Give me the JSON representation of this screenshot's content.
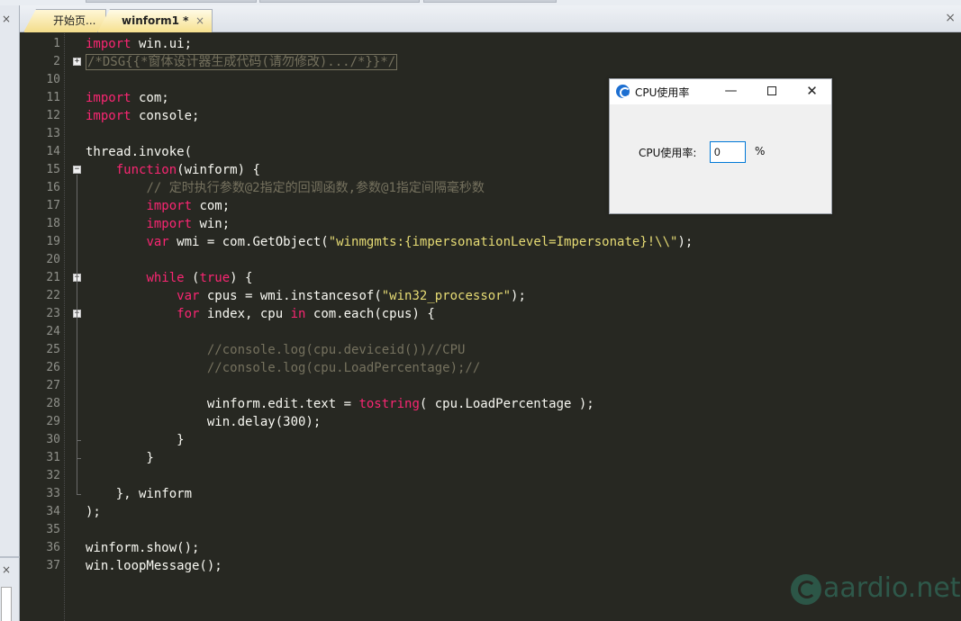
{
  "tabs": [
    {
      "label": "开始页...",
      "active": false
    },
    {
      "label": "winform1 *",
      "active": true,
      "close": "×"
    }
  ],
  "tabbar_close": "×",
  "left_panel": {
    "close_top": "×",
    "close_bottom": "×"
  },
  "editor": {
    "lines": [
      {
        "num": "1",
        "html": "<span class='kw'>import</span> win.ui;"
      },
      {
        "num": "2",
        "html": "<span class='dsg'>/*DSG{{*窗体设计器生成代码(请勿修改).../*}}*/</span>"
      },
      {
        "num": "10",
        "html": ""
      },
      {
        "num": "11",
        "html": "<span class='kw'>import</span> com;"
      },
      {
        "num": "12",
        "html": "<span class='kw'>import</span> console;"
      },
      {
        "num": "13",
        "html": ""
      },
      {
        "num": "14",
        "html": "thread.invoke("
      },
      {
        "num": "15",
        "html": "    <span class='kw'>function</span>(winform) {"
      },
      {
        "num": "16",
        "html": "        <span class='cmt'>// 定时执行参数@2指定的回调函数,参数@1指定间隔毫秒数</span>"
      },
      {
        "num": "17",
        "html": "        <span class='kw'>import</span> com;"
      },
      {
        "num": "18",
        "html": "        <span class='kw'>import</span> win;"
      },
      {
        "num": "19",
        "html": "        <span class='kw'>var</span> wmi = com.GetObject(<span class='str'>\"winmgmts:{impersonationLevel=Impersonate}!\\\\\"</span>);"
      },
      {
        "num": "20",
        "html": ""
      },
      {
        "num": "21",
        "html": "        <span class='kw'>while</span> (<span class='kw'>true</span>) {"
      },
      {
        "num": "22",
        "html": "            <span class='kw'>var</span> cpus = wmi.instancesof(<span class='str'>\"win32_processor\"</span>);"
      },
      {
        "num": "23",
        "html": "            <span class='kw'>for</span> index, cpu <span class='kw'>in</span> com.each(cpus) {"
      },
      {
        "num": "24",
        "html": ""
      },
      {
        "num": "25",
        "html": "                <span class='cmt'>//console.log(cpu.deviceid())//CPU</span>"
      },
      {
        "num": "26",
        "html": "                <span class='cmt'>//console.log(cpu.LoadPercentage);//</span>"
      },
      {
        "num": "27",
        "html": ""
      },
      {
        "num": "28",
        "html": "                winform.edit.text = <span class='kw'>tostring</span>( cpu.LoadPercentage );"
      },
      {
        "num": "29",
        "html": "                win.delay(300);"
      },
      {
        "num": "30",
        "html": "            }"
      },
      {
        "num": "31",
        "html": "        }"
      },
      {
        "num": "32",
        "html": ""
      },
      {
        "num": "33",
        "html": "    }, winform"
      },
      {
        "num": "34",
        "html": ");"
      },
      {
        "num": "35",
        "html": ""
      },
      {
        "num": "36",
        "html": "winform.show();"
      },
      {
        "num": "37",
        "html": "win.loopMessage();"
      }
    ],
    "fold_markers": [
      {
        "line_index": 1,
        "symbol": "+"
      },
      {
        "line_index": 7,
        "symbol": "−"
      },
      {
        "line_index": 13,
        "symbol": "−"
      },
      {
        "line_index": 15,
        "symbol": "−"
      }
    ]
  },
  "cpu_window": {
    "title": "CPU使用率",
    "minimize": "—",
    "close": "✕",
    "label": "CPU使用率:",
    "edit_value": "0",
    "percent": "%"
  },
  "watermark": {
    "text": "aardio.net"
  }
}
